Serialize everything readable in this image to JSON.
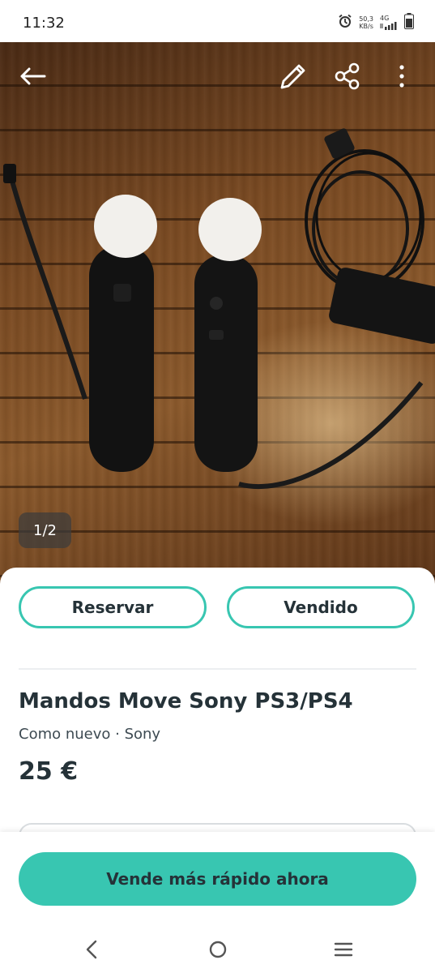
{
  "status_bar": {
    "time": "11:32",
    "net_speed": "50,3",
    "net_unit": "KB/s",
    "net_type": "4G",
    "icons": [
      "alarm-icon",
      "signal-icon",
      "battery-icon"
    ]
  },
  "top_bar": {
    "icons": [
      "back-arrow-icon",
      "edit-pencil-icon",
      "share-icon",
      "more-vertical-icon"
    ]
  },
  "gallery": {
    "counter": "1/2"
  },
  "actions": {
    "reserve_label": "Reservar",
    "sold_label": "Vendido"
  },
  "listing": {
    "title": "Mandos Move Sony PS3/PS4",
    "subtitle": "Como nuevo · Sony",
    "price": "25 €"
  },
  "cta": {
    "label": "Vende más rápido ahora"
  },
  "navbar": {
    "icons": [
      "nav-back-icon",
      "nav-home-icon",
      "nav-recents-icon"
    ]
  },
  "colors": {
    "accent": "#38c6b1",
    "text": "#253238"
  }
}
